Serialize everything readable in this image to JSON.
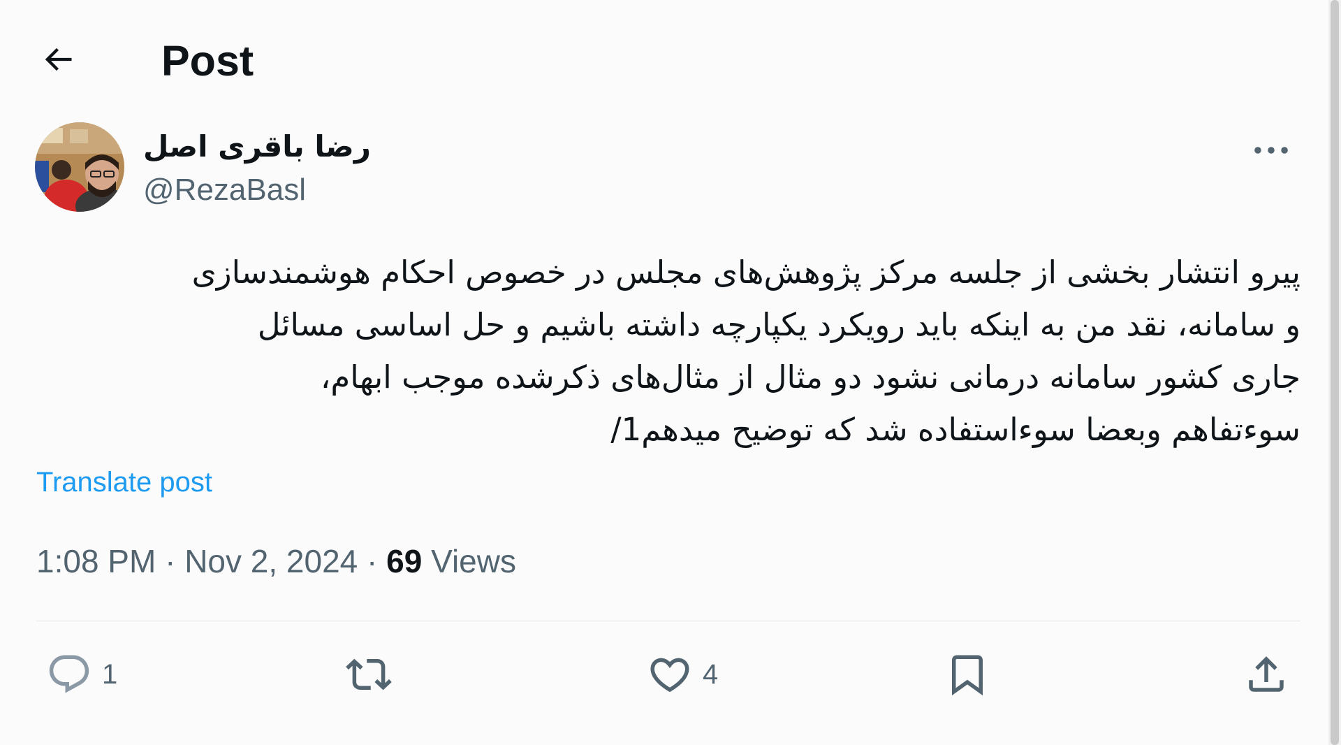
{
  "header": {
    "back_icon": "arrow-left-icon",
    "title": "Post"
  },
  "author": {
    "display_name": "رضا باقری اصل",
    "handle": "@RezaBasl",
    "more_icon": "more-horizontal-icon"
  },
  "post": {
    "lines": [
      "پیرو انتشار بخشی از جلسه مرکز پژوهش‌های مجلس در خصوص احکام هوشمندسازی",
      "و سامانه، نقد من به اینکه باید رویکرد یکپارچه  داشته باشیم و حل اساسی مسائل",
      "جاری کشور  سامانه درمانی نشود دو مثال از مثال‌های ذکرشده موجب ابهام،",
      "سوءتفاهم وبعضا سوءاستفاده شد که توضیح میدهم1/"
    ],
    "translate_label": "Translate post"
  },
  "meta": {
    "time": "1:08 PM",
    "separator": "·",
    "date": "Nov 2, 2024",
    "views_count": "69",
    "views_label": "Views"
  },
  "actions": {
    "reply_count": "1",
    "like_count": "4",
    "icons": [
      "reply-icon",
      "repost-icon",
      "like-icon",
      "bookmark-icon",
      "share-icon"
    ]
  },
  "colors": {
    "text_primary": "#0f1419",
    "text_secondary": "#536471",
    "link": "#1d9bf0"
  }
}
